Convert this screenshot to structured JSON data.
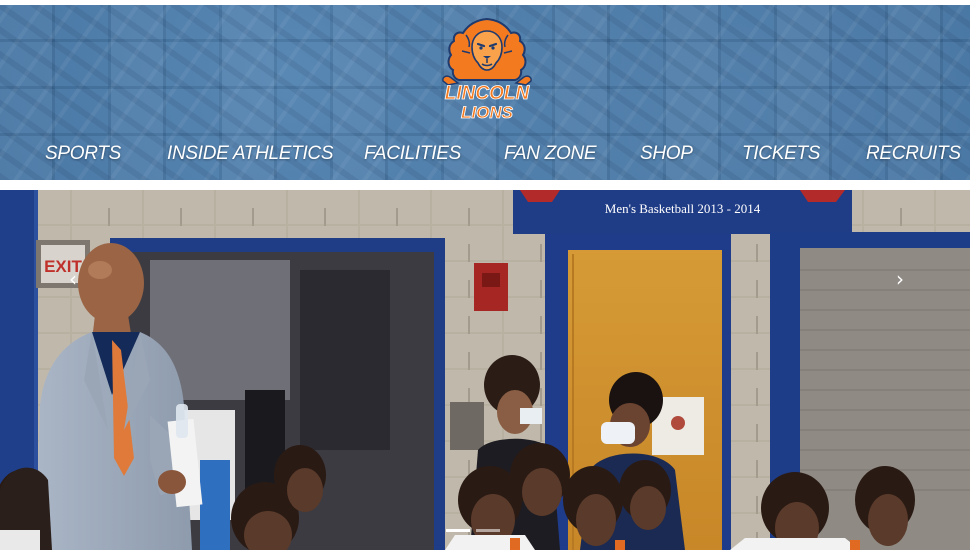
{
  "header": {
    "logo": {
      "line1": "LINCOLN",
      "line2": "LIONS",
      "icon": "lion-head-icon",
      "colors": {
        "orange": "#f47a20",
        "navy": "#1e3a6e"
      }
    },
    "nav": [
      {
        "label": "SPORTS"
      },
      {
        "label": "INSIDE ATHLETICS"
      },
      {
        "label": "FACILITIES"
      },
      {
        "label": "FAN ZONE"
      },
      {
        "label": "SHOP"
      },
      {
        "label": "TICKETS"
      },
      {
        "label": "RECRUITS"
      }
    ],
    "background_color": "#3a6a9a"
  },
  "hero": {
    "banner_text": "Men's Basketball 2013 - 2014",
    "exit_sign": "EXIT",
    "prev_icon": "chevron-left-icon",
    "next_icon": "chevron-right-icon",
    "slide_count": 2,
    "active_slide": 1
  }
}
